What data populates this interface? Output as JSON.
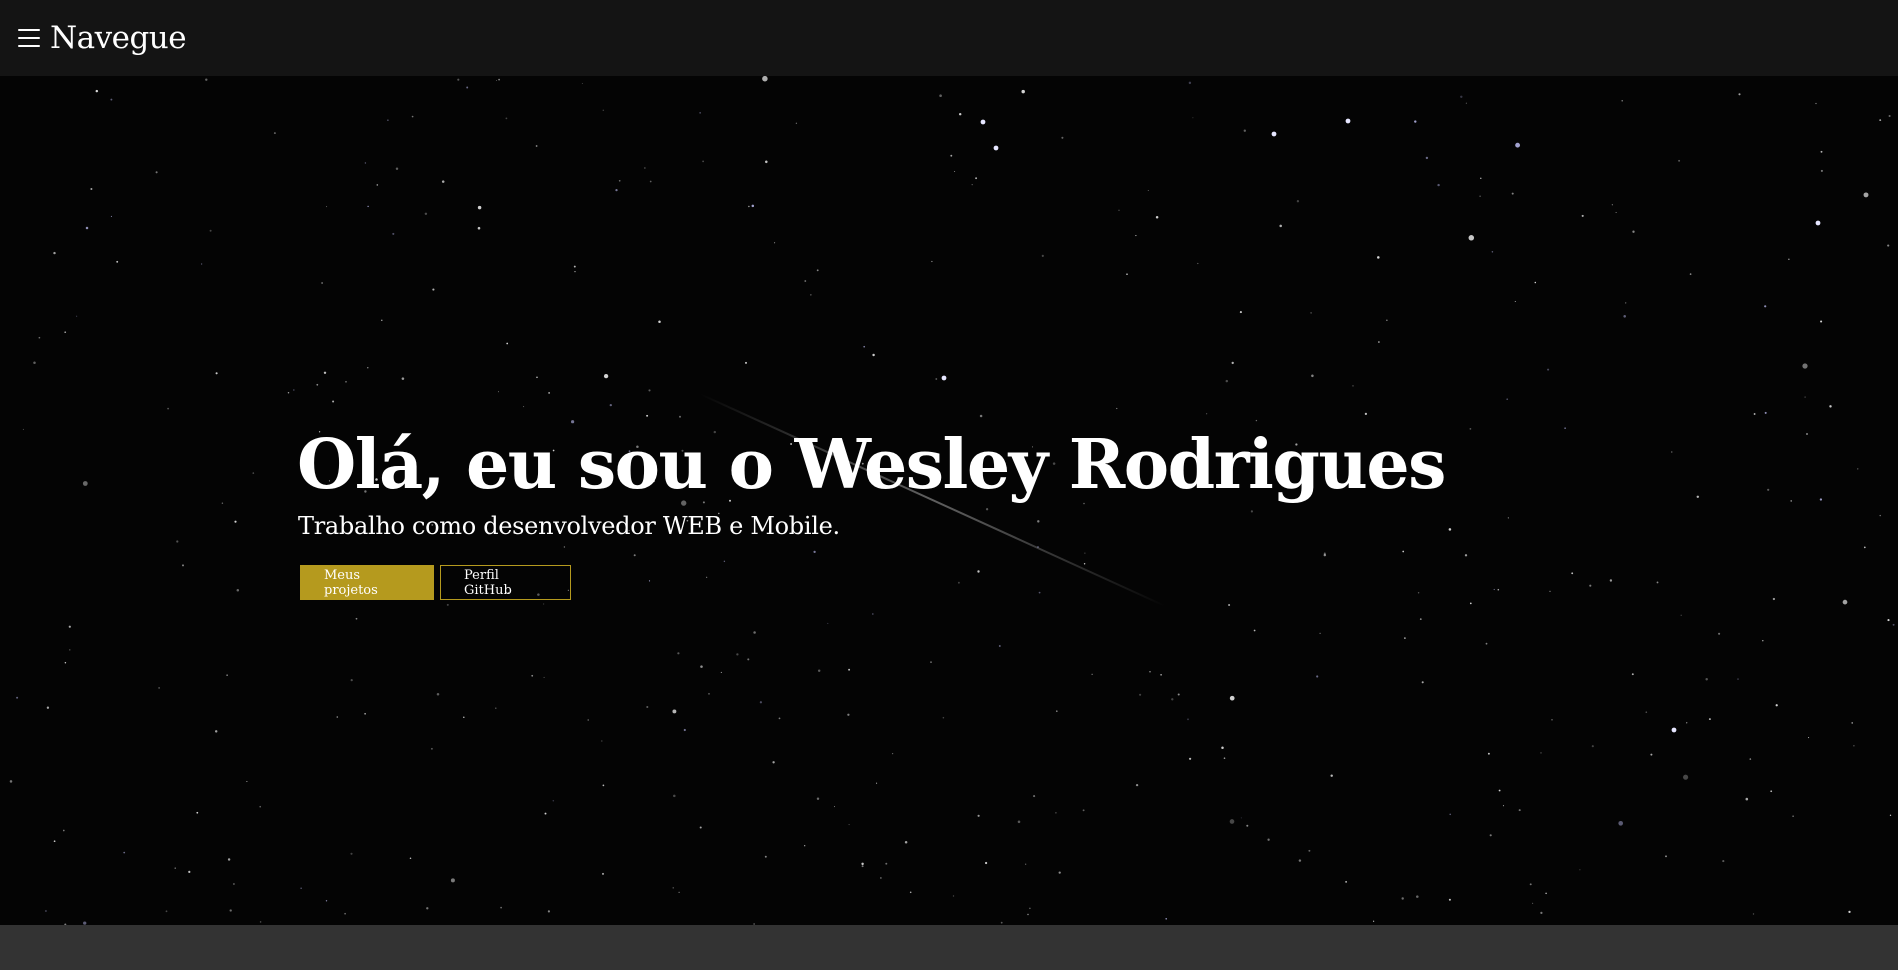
{
  "nav": {
    "title": "Navegue",
    "menu_icon": "hamburger-menu-icon"
  },
  "hero": {
    "title": "Olá, eu sou o Wesley Rodrigues",
    "subtitle": "Trabalho como desenvolvedor WEB e Mobile.",
    "buttons": {
      "projects_label": "Meus projetos",
      "github_label": "Perfil GitHub"
    }
  },
  "colors": {
    "accent": "#b59a1e",
    "topbar": "#141414",
    "hero_background": "#040404",
    "footer": "#333333"
  }
}
